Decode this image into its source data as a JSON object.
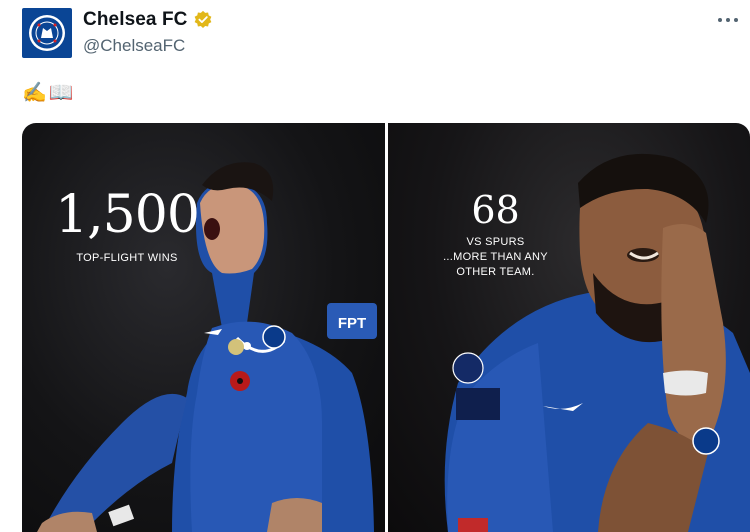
{
  "header": {
    "display_name": "Chelsea FC",
    "handle": "@ChelseaFC",
    "verified": true,
    "more_icon": "more-horizontal-icon",
    "avatar_icon": "chelsea-crest-icon"
  },
  "tweet": {
    "emoji_1": "✍️",
    "emoji_2": "📖"
  },
  "media": {
    "left": {
      "stat_number": "1,500",
      "stat_caption": "TOP-FLIGHT WINS"
    },
    "right": {
      "stat_number": "68",
      "stat_caption_line1": "VS SPURS",
      "stat_caption_line2": "...MORE THAN ANY",
      "stat_caption_line3": "OTHER TEAM."
    }
  },
  "colors": {
    "chelsea_blue": "#0a4595",
    "verified_gold": "#e2b719",
    "text_primary": "#0f1419",
    "text_secondary": "#536471"
  }
}
